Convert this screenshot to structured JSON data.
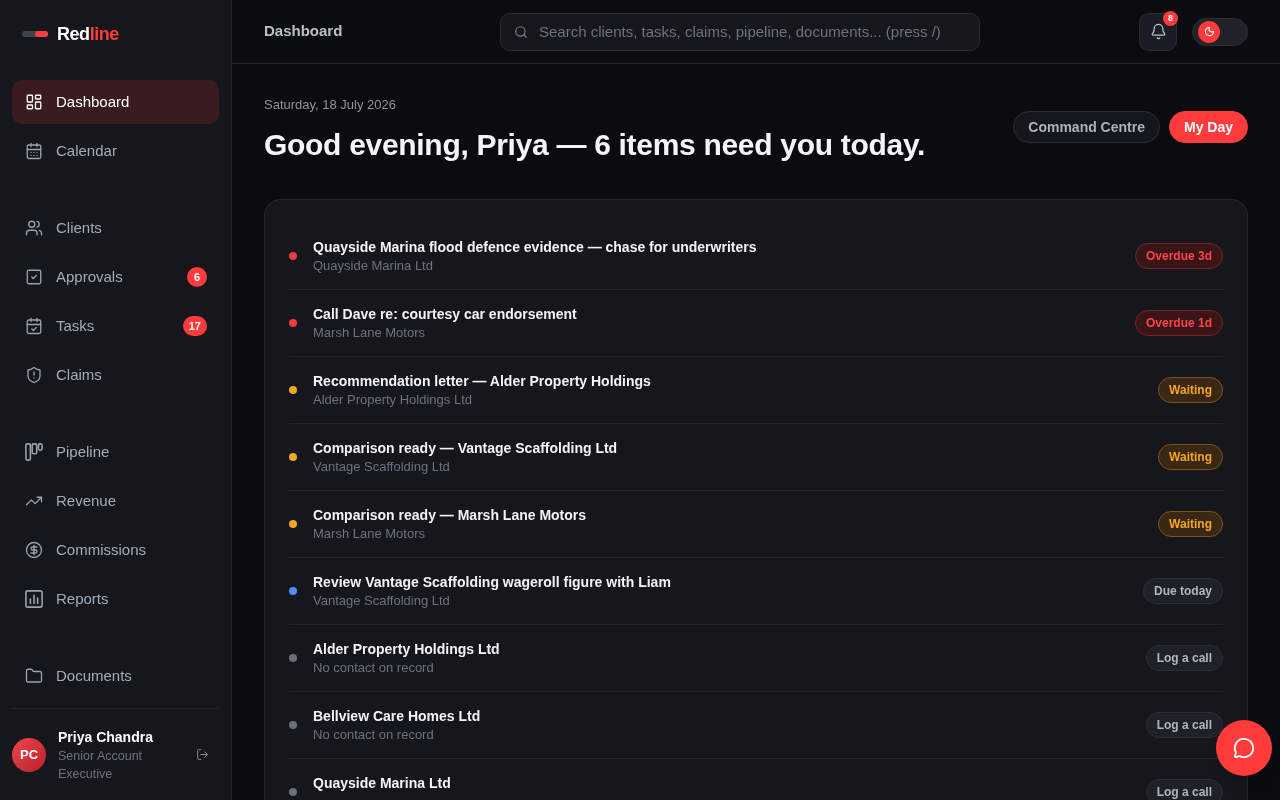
{
  "sidebar": {
    "logo": {
      "lead": "Red",
      "accent": "line"
    },
    "nav_groups": [
      {
        "items": [
          {
            "label": "Dashboard",
            "selected": true
          },
          {
            "label": "Calendar",
            "selected": false
          }
        ]
      },
      {
        "items": [
          {
            "label": "Clients",
            "selected": false
          },
          {
            "label": "Approvals",
            "selected": false,
            "badge": "6"
          },
          {
            "label": "Tasks",
            "selected": false,
            "badge": "17"
          },
          {
            "label": "Claims",
            "selected": false
          }
        ]
      },
      {
        "items": [
          {
            "label": "Pipeline",
            "selected": false
          },
          {
            "label": "Revenue",
            "selected": false
          },
          {
            "label": "Commissions",
            "selected": false
          },
          {
            "label": "Reports",
            "selected": false
          }
        ]
      },
      {
        "items": [
          {
            "label": "Documents",
            "selected": false
          }
        ]
      }
    ],
    "user": {
      "initials": "PC",
      "name": "Priya Chandra",
      "role": "Senior Account Executive"
    }
  },
  "header": {
    "title": "Dashboard",
    "search": {
      "placeholder": "Search clients, tasks, claims, pipeline, documents... (press /)"
    },
    "notifications": {
      "count": "8"
    },
    "theme_switch": {
      "light": false
    }
  },
  "greeting": {
    "date": "Saturday, 18 July 2026",
    "heading": "Good evening, Priya — 6 items need you today."
  },
  "view_switch": [
    {
      "label": "Command Centre",
      "selected": false
    },
    {
      "label": "My Day",
      "selected": true
    }
  ],
  "tasks": [
    {
      "title": "Quayside Marina flood defence evidence — chase for underwriters",
      "subtitle": "Quayside Marina Ltd",
      "color": "#ef3b3b",
      "status": {
        "kind": "overdue",
        "label": "Overdue 3d"
      }
    },
    {
      "title": "Call Dave re: courtesy car endorsement",
      "subtitle": "Marsh Lane Motors",
      "color": "#ef3b3b",
      "status": {
        "kind": "overdue",
        "label": "Overdue 1d"
      }
    },
    {
      "title": "Recommendation letter — Alder Property Holdings",
      "subtitle": "Alder Property Holdings Ltd",
      "color": "#f5a623",
      "status": {
        "kind": "waiting",
        "label": "Waiting"
      }
    },
    {
      "title": "Comparison ready — Vantage Scaffolding Ltd",
      "subtitle": "Vantage Scaffolding Ltd",
      "color": "#f5a623",
      "status": {
        "kind": "waiting",
        "label": "Waiting"
      }
    },
    {
      "title": "Comparison ready — Marsh Lane Motors",
      "subtitle": "Marsh Lane Motors",
      "color": "#f5a623",
      "status": {
        "kind": "waiting",
        "label": "Waiting"
      }
    },
    {
      "title": "Review Vantage Scaffolding wageroll figure with Liam",
      "subtitle": "Vantage Scaffolding Ltd",
      "color": "#4f8ff7",
      "status": {
        "kind": "due",
        "label": "Due today"
      }
    },
    {
      "title": "Alder Property Holdings Ltd",
      "subtitle": "No contact on record",
      "color": "#6b6f78",
      "status": {
        "kind": "action",
        "label": "Log a call"
      }
    },
    {
      "title": "Bellview Care Homes Ltd",
      "subtitle": "No contact on record",
      "color": "#6b6f78",
      "status": {
        "kind": "action",
        "label": "Log a call"
      }
    },
    {
      "title": "Quayside Marina Ltd",
      "color": "#6b6f78",
      "status": {
        "kind": "action",
        "label": "Log a call"
      }
    }
  ]
}
